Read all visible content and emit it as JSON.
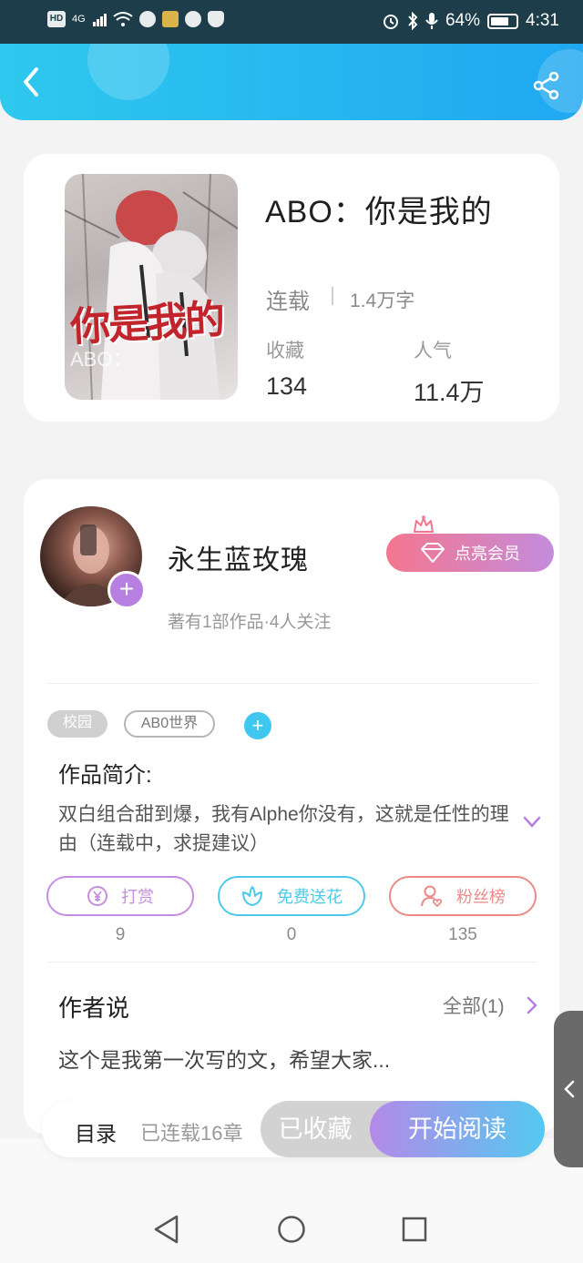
{
  "status_bar": {
    "network": "4G",
    "battery": "64%",
    "time": "4:31"
  },
  "header": {
    "back_icon": "chevron-left-icon",
    "share_icon": "share-icon"
  },
  "book": {
    "title": "ABO：你是我的",
    "cover_text": "你是我的",
    "cover_subtext": "ABO：",
    "status": "连载",
    "word_count": "1.4万字",
    "favorites_label": "收藏",
    "favorites_value": "134",
    "popularity_label": "人气",
    "popularity_value": "11.4万"
  },
  "author": {
    "name": "永生蓝玫瑰",
    "meta": "著有1部作品·4人关注",
    "follow_icon": "plus-icon",
    "vip_label": "点亮会员"
  },
  "tags": [
    "校园",
    "AB0世界"
  ],
  "intro": {
    "title": "作品简介:",
    "text": "双白组合甜到爆，我有Alphe你没有，这就是任性的理由（连载中，求提建议）"
  },
  "actions": [
    {
      "label": "打赏",
      "count": "9",
      "color": "#c58ee0",
      "icon": "yen-coin-icon"
    },
    {
      "label": "免费送花",
      "count": "0",
      "color": "#4ccbe8",
      "icon": "flower-icon"
    },
    {
      "label": "粉丝榜",
      "count": "135",
      "color": "#ec8a8a",
      "icon": "fan-user-icon"
    }
  ],
  "author_says": {
    "title": "作者说",
    "all_label": "全部(1)",
    "text": "这个是我第一次写的文，希望大家..."
  },
  "bottom": {
    "toc_label": "目录",
    "toc_count": "已连载16章",
    "collect_label": "已收藏",
    "read_label": "开始阅读"
  },
  "colors": {
    "header_start": "#2fc8ee",
    "header_end": "#1fa8f1",
    "accent_purple": "#b77fe0",
    "vip_start": "#f4768e",
    "vip_end": "#c48cdc"
  }
}
